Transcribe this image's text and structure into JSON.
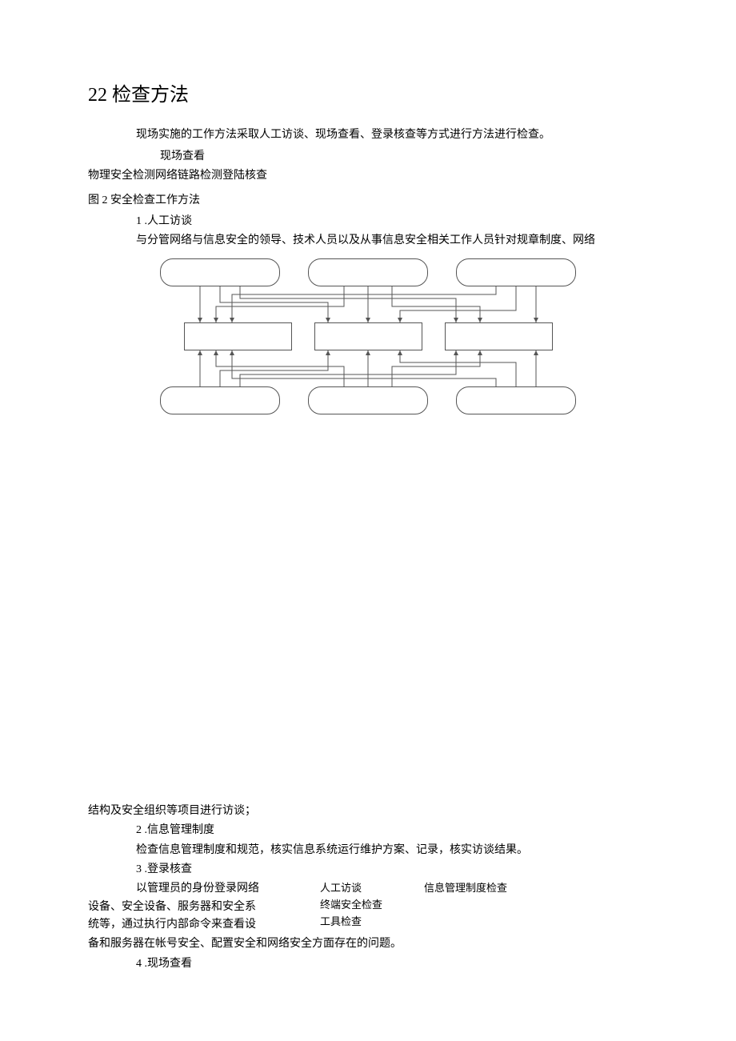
{
  "heading": "22 检查方法",
  "intro": "现场实施的工作方法采取人工访谈、现场查看、登录核查等方式进行方法进行检查。",
  "sub_label": "现场查看",
  "inline_methods": "物理安全检测网络链路检测登陆核查",
  "fig_caption": "图 2 安全检查工作方法",
  "item1_num": "1 .人工访谈",
  "item1_para": "与分管网络与信息安全的领导、技术人员以及从事信息安全相关工作人员针对规章制度、网络",
  "resume_para": "结构及安全组织等项目进行访谈；",
  "item2_num": "2 .信息管理制度",
  "item2_para": "检查信息管理制度和规范，核实信息系统运行维护方案、记录，核实访谈结果。",
  "item3_num": "3 .登录核查",
  "item3_para_l1": "以管理员的身份登录网络",
  "item3_para_l2": "设备、安全设备、服务器和安全系",
  "item3_para_l3": "统等，通过执行内部命令来查看设",
  "item3_para_merged": "备和服务器在帐号安全、配置安全和网络安全方面存在的问题。",
  "right_r1c1": "人工访谈",
  "right_r1c2": "信息管理制度检查",
  "right_r2c1": "终端安全检查",
  "right_r3c1": "工具检查",
  "item4_num": "4 .现场查看"
}
